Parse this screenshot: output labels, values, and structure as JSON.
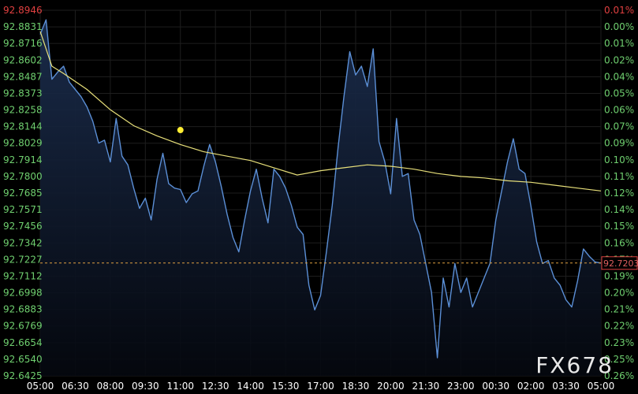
{
  "chart_data": {
    "type": "line",
    "watermark": "FX678",
    "colors": {
      "background": "#000000",
      "price_line": "#5b8fd6",
      "area_fill_top": "#1a2a45",
      "moving_average": "#e8e07a",
      "marker": "#ffee33",
      "left_axis_text": "#6fcf6f",
      "left_axis_top_text": "#e04040",
      "right_axis_text": "#6fcf6f",
      "right_axis_top_text": "#e04040",
      "current_price_line": "#e0a040",
      "current_price_box_border": "#e04040",
      "current_price_box_text": "#e06060",
      "grid": "#1e1e1e",
      "x_axis_text": "#ffffff"
    },
    "ylim": [
      92.6425,
      92.8946
    ],
    "y_ticks_left": [
      "92.8946",
      "92.8831",
      "92.8716",
      "92.8602",
      "92.8487",
      "92.8373",
      "92.8258",
      "92.8144",
      "92.8029",
      "92.7914",
      "92.7800",
      "92.7685",
      "92.7571",
      "92.7456",
      "92.7342",
      "92.7227",
      "92.7112",
      "92.6998",
      "92.6883",
      "92.6769",
      "92.6654",
      "92.6540",
      "92.6425"
    ],
    "y_ticks_right": [
      "0.01%",
      "0.00%",
      "0.01%",
      "0.02%",
      "0.04%",
      "0.05%",
      "0.06%",
      "0.07%",
      "0.09%",
      "0.10%",
      "0.11%",
      "0.12%",
      "0.14%",
      "0.15%",
      "0.16%",
      "0.17%",
      "0.19%",
      "0.20%",
      "0.21%",
      "0.22%",
      "0.23%",
      "0.25%",
      "0.26%"
    ],
    "x_ticks": [
      "05:00",
      "06:30",
      "08:00",
      "09:30",
      "11:00",
      "12:30",
      "14:00",
      "15:30",
      "17:00",
      "18:30",
      "20:00",
      "21:30",
      "23:00",
      "00:30",
      "02:00",
      "03:30",
      "05:00"
    ],
    "current_price": "92.7203",
    "price_series": {
      "name": "",
      "x_hours": [
        0,
        0.25,
        0.5,
        0.75,
        1,
        1.25,
        1.5,
        1.75,
        2,
        2.25,
        2.5,
        2.75,
        3,
        3.25,
        3.5,
        3.75,
        4,
        4.25,
        4.5,
        4.75,
        5,
        5.25,
        5.5,
        5.75,
        6,
        6.25,
        6.5,
        6.75,
        7,
        7.25,
        7.5,
        7.75,
        8,
        8.25,
        8.5,
        8.75,
        9,
        9.25,
        9.5,
        9.75,
        10,
        10.25,
        10.5,
        10.75,
        11,
        11.25,
        11.5,
        11.75,
        12,
        12.25,
        12.5,
        12.75,
        13,
        13.25,
        13.5,
        13.75,
        14,
        14.25,
        14.5,
        14.75,
        15,
        15.25,
        15.5,
        15.75,
        16,
        16.25,
        16.5,
        16.75,
        17,
        17.25,
        17.5,
        17.75,
        18,
        18.25,
        18.5,
        18.75,
        19,
        19.25,
        19.5,
        19.75,
        20,
        20.25,
        20.5,
        20.75,
        21,
        21.25,
        21.5,
        21.75,
        22,
        22.25,
        22.5,
        22.75,
        23,
        23.25,
        23.5,
        23.75,
        24
      ],
      "values": [
        92.878,
        92.888,
        92.847,
        92.852,
        92.856,
        92.845,
        92.84,
        92.835,
        92.828,
        92.818,
        92.803,
        92.805,
        92.79,
        92.82,
        92.794,
        92.788,
        92.772,
        92.758,
        92.765,
        92.75,
        92.778,
        92.796,
        92.775,
        92.772,
        92.771,
        92.762,
        92.768,
        92.77,
        92.787,
        92.802,
        92.79,
        92.773,
        92.754,
        92.738,
        92.728,
        92.75,
        92.77,
        92.785,
        92.765,
        92.748,
        92.785,
        92.78,
        92.772,
        92.76,
        92.745,
        92.74,
        92.705,
        92.688,
        92.698,
        92.728,
        92.76,
        92.8,
        92.835,
        92.866,
        92.85,
        92.856,
        92.842,
        92.868,
        92.804,
        92.79,
        92.768,
        92.82,
        92.78,
        92.782,
        92.75,
        92.74,
        92.72,
        92.7,
        92.655,
        92.71,
        92.69,
        92.72,
        92.7,
        92.71,
        92.69,
        92.7,
        92.71,
        92.72,
        92.75,
        92.77,
        92.79,
        92.806,
        92.785,
        92.782,
        92.76,
        92.735,
        92.72,
        92.722,
        92.71,
        92.705,
        92.695,
        92.69,
        92.708,
        92.73,
        92.725,
        92.721,
        92.7203
      ]
    },
    "moving_average": {
      "name": "",
      "x_hours": [
        0,
        0.5,
        1,
        2,
        3,
        4,
        5,
        6,
        7,
        8,
        9,
        10,
        11,
        12,
        13,
        14,
        15,
        16,
        17,
        18,
        19,
        20,
        21,
        22,
        23,
        24
      ],
      "values": [
        92.88,
        92.856,
        92.851,
        92.84,
        92.826,
        92.815,
        92.808,
        92.802,
        92.797,
        92.794,
        92.791,
        92.786,
        92.781,
        92.784,
        92.786,
        92.788,
        92.787,
        92.785,
        92.782,
        92.78,
        92.779,
        92.777,
        92.776,
        92.774,
        92.772,
        92.77
      ]
    },
    "marker": {
      "x_hour": 6.0,
      "value": 92.812
    }
  }
}
